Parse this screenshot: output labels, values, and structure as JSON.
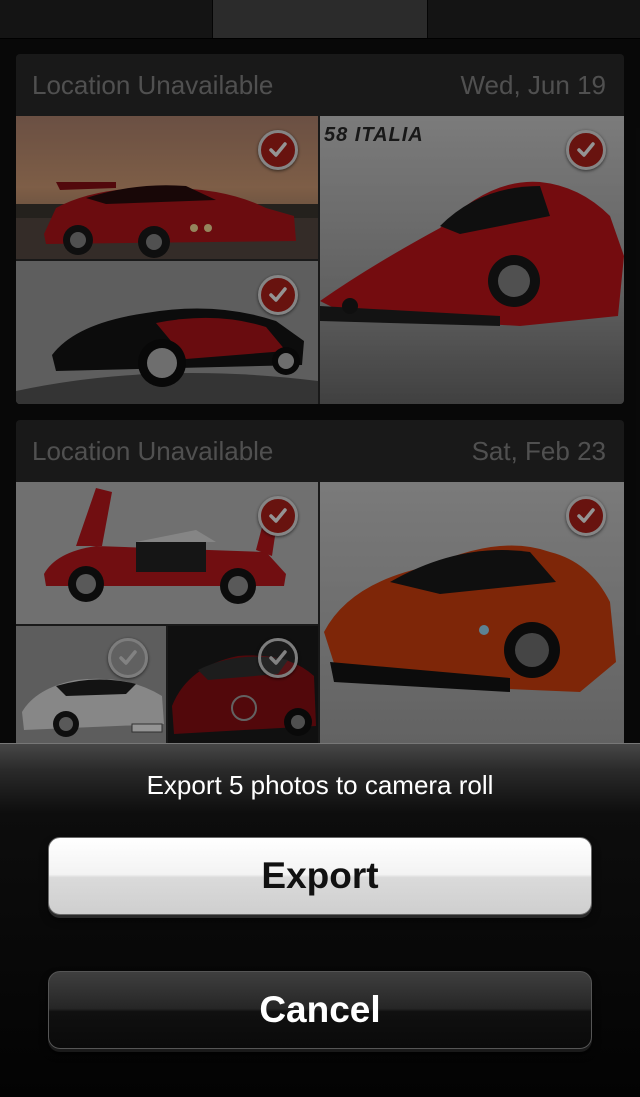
{
  "tabs": [
    {
      "id": "tab-1",
      "selected": false
    },
    {
      "id": "tab-2",
      "selected": true
    },
    {
      "id": "tab-3",
      "selected": false
    }
  ],
  "sections": [
    {
      "location": "Location Unavailable",
      "date": "Wed, Jun 19",
      "photos": [
        {
          "subject": "red sports car at sunset",
          "selected": true
        },
        {
          "subject": "red Ferrari 458 Italia",
          "selected": true,
          "caption": "58 ITALIA"
        },
        {
          "subject": "black and red concept car",
          "selected": true
        }
      ]
    },
    {
      "location": "Location Unavailable",
      "date": "Sat, Feb 23",
      "photos": [
        {
          "subject": "red car with doors open",
          "selected": true
        },
        {
          "subject": "orange McLaren P1",
          "selected": true
        },
        {
          "subject": "white Audi R8",
          "selected": false
        },
        {
          "subject": "red Audi concept",
          "selected": false
        }
      ]
    }
  ],
  "sheet": {
    "title": "Export 5 photos to camera roll",
    "export_label": "Export",
    "cancel_label": "Cancel"
  },
  "colors": {
    "check_selected": "#b3221b",
    "background": "#0f0f0f"
  }
}
